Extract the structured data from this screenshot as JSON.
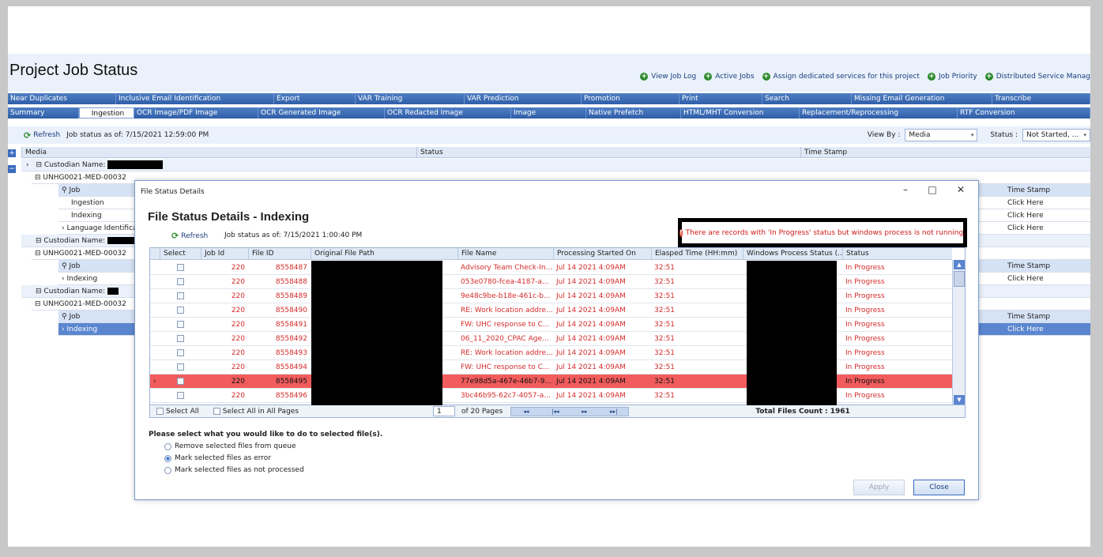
{
  "page": {
    "title": "Project Job Status",
    "links": [
      "View Job Log",
      "Active Jobs",
      "Assign dedicated services for this project",
      "Job Priority",
      "Distributed Service Manag"
    ]
  },
  "tabs_row1": [
    "Near Duplicates",
    "Inclusive Email Identification",
    "Export",
    "VAR Training",
    "VAR Prediction",
    "Promotion",
    "Print",
    "Search",
    "Missing Email Generation",
    "Transcribe"
  ],
  "tabs_row2": [
    "Summary",
    "Ingestion",
    "OCR Image/PDF Image",
    "OCR Generated Image",
    "OCR Redacted Image",
    "Image",
    "Native Prefetch",
    "HTML/MHT Conversion",
    "Replacement/Reprocessing",
    "RTF Conversion"
  ],
  "tabs_row2_active": "Ingestion",
  "toolbar": {
    "refresh": "Refresh",
    "job_status_as_of": "Job status as of: 7/15/2021 12:59:00 PM",
    "view_by_label": "View By :",
    "view_by_value": "Media",
    "status_label": "Status :",
    "status_value": "Not Started, ..."
  },
  "grid": {
    "headers": [
      "Media",
      "Status",
      "Time Stamp"
    ],
    "custodian_label": "Custodian Name:",
    "media_1": "UNHG0021-MED-00032",
    "media_2": "UNHG0021-MED-00032",
    "media_3": "UNHG0021-MED-00032",
    "job_header": "Job",
    "ts_header": "Time Stamp",
    "jobs_1": [
      "Ingestion",
      "Indexing",
      "Language Identifica"
    ],
    "jobs_2": [
      "Indexing"
    ],
    "jobs_3": [
      "Indexing"
    ],
    "click_here": "Click Here"
  },
  "dialog": {
    "window_title": "File Status Details",
    "heading": "File Status Details - Indexing",
    "refresh": "Refresh",
    "job_status_as_of": "Job status as of: 7/15/2021 1:00:40 PM",
    "warning": "There are records with 'In Progress' status but windows process is not running.",
    "columns": [
      "Select",
      "Job Id",
      "File ID",
      "Original File Path",
      "File Name",
      "Processing Started On",
      "Elasped Time (HH:mm)",
      "Windows Process Status (...",
      "Status"
    ],
    "rows": [
      {
        "job_id": "220",
        "file_id": "8558487",
        "file_name": "Advisory Team Check-In...",
        "started": "Jul 14 2021 4:09AM",
        "elapsed": "32:51",
        "status": "In Progress"
      },
      {
        "job_id": "220",
        "file_id": "8558488",
        "file_name": "053e0780-fcea-4187-a...",
        "started": "Jul 14 2021 4:09AM",
        "elapsed": "32:51",
        "status": "In Progress"
      },
      {
        "job_id": "220",
        "file_id": "8558489",
        "file_name": "9e48c9be-b18e-461c-b...",
        "started": "Jul 14 2021 4:09AM",
        "elapsed": "32:51",
        "status": "In Progress"
      },
      {
        "job_id": "220",
        "file_id": "8558490",
        "file_name": "RE: Work location addre...",
        "started": "Jul 14 2021 4:09AM",
        "elapsed": "32:51",
        "status": "In Progress"
      },
      {
        "job_id": "220",
        "file_id": "8558491",
        "file_name": "FW: UHC response to C...",
        "started": "Jul 14 2021 4:09AM",
        "elapsed": "32:51",
        "status": "In Progress"
      },
      {
        "job_id": "220",
        "file_id": "8558492",
        "file_name": "06_11_2020_CPAC Age...",
        "started": "Jul 14 2021 4:09AM",
        "elapsed": "32:51",
        "status": "In Progress"
      },
      {
        "job_id": "220",
        "file_id": "8558493",
        "file_name": "RE: Work location addre...",
        "started": "Jul 14 2021 4:09AM",
        "elapsed": "32:51",
        "status": "In Progress"
      },
      {
        "job_id": "220",
        "file_id": "8558494",
        "file_name": "FW: UHC response to C...",
        "started": "Jul 14 2021 4:09AM",
        "elapsed": "32:51",
        "status": "In Progress"
      },
      {
        "job_id": "220",
        "file_id": "8558495",
        "file_name": "77e98d5a-467e-46b7-9...",
        "started": "Jul 14 2021 4:09AM",
        "elapsed": "32:51",
        "status": "In Progress"
      },
      {
        "job_id": "220",
        "file_id": "8558496",
        "file_name": "3bc46b95-62c7-4057-a...",
        "started": "Jul 14 2021 4:09AM",
        "elapsed": "32:51",
        "status": "In Progress"
      }
    ],
    "select_all": "Select All",
    "select_all_pages": "Select All in All Pages",
    "page_number": "1",
    "page_total": "of 20 Pages",
    "total_files": "Total Files Count : 1961",
    "question": "Please select what you would like to do to selected file(s).",
    "options": [
      "Remove selected files from queue",
      "Mark selected files as error",
      "Mark selected files as not processed"
    ],
    "selected_option": 1,
    "apply": "Apply",
    "close": "Close"
  }
}
